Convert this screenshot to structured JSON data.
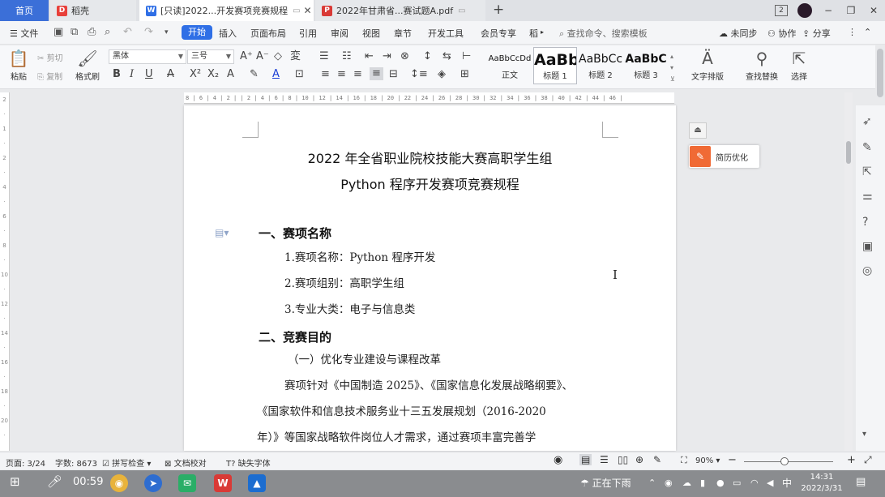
{
  "tabs": {
    "home": "首页",
    "daoke": "稻壳",
    "doc": "[只读]2022...开发赛项竞赛规程",
    "pdf": "2022年甘肃省...赛试题A.pdf",
    "new_tab": "+"
  },
  "window_controls": {
    "layout": "2",
    "minimize": "−",
    "restore": "❐",
    "close": "✕"
  },
  "menu": {
    "file": "文件",
    "start": "开始",
    "items": [
      "插入",
      "页面布局",
      "引用",
      "审阅",
      "视图",
      "章节",
      "开发工具",
      "会员专享",
      "稻"
    ],
    "search": "查找命令、搜索模板",
    "unsynced": "未同步",
    "collaborate": "协作",
    "share": "分享"
  },
  "ribbon": {
    "paste": "粘贴",
    "cut": "剪切",
    "copy": "复制",
    "format_painter": "格式刷",
    "font_name": "黑体",
    "font_size": "三号",
    "styles": [
      {
        "sample": "AaBbCcDd",
        "label": "正文"
      },
      {
        "sample": "AaBb",
        "label": "标题 1"
      },
      {
        "sample": "AaBbCc",
        "label": "标题 2"
      },
      {
        "sample": "AaBbC",
        "label": "标题 3"
      }
    ],
    "text_layout": "文字排版",
    "find_replace": "查找替换",
    "select": "选择"
  },
  "ruler": {
    "marks": "8 | 6 | 4 | 2 |   | 2 | 4 | 6 | 8 | 10 | 12 | 14 | 16 | 18 | 20 | 22 | 24 | 26 | 28 | 30 | 32 | 34 | 36 | 38 | 40 | 42 | 44 | 46 |"
  },
  "document": {
    "title_line1": "2022 年全省职业院校技能大赛高职学生组",
    "title_line2": "Python 程序开发赛项竞赛规程",
    "section1": "一、赛项名称",
    "item1": "1.赛项名称：Python 程序开发",
    "item2": "2.赛项组别：高职学生组",
    "item3": "3.专业大类：电子与信息类",
    "section2": "二、竞赛目的",
    "subsection1": "（一）优化专业建设与课程改革",
    "para_line1": "赛项针对《中国制造 2025》、《国家信息化发展战略纲要》、",
    "para_line2": "《国家软件和信息技术服务业十三五发展规划（2016-2020",
    "para_line3": "年）》等国家战略软件岗位人才需求，通过赛项丰富完善学"
  },
  "side_panel": {
    "resume": "简历优化"
  },
  "status": {
    "page": "页面: 3/24",
    "words": "字数: 8673",
    "spellcheck": "拼写检查",
    "proofread": "文档校对",
    "missing_font": "缺失字体",
    "zoom": "90%"
  },
  "taskbar": {
    "time_display": "00:59",
    "weather": "正在下雨",
    "ime": "中",
    "clock_time": "14:31",
    "clock_date": "2022/3/31"
  },
  "colors": {
    "accent": "#2f6fe6",
    "home_tab": "#3b6fd8",
    "wps_red": "#d93a36",
    "resume_orange": "#f06a35"
  }
}
